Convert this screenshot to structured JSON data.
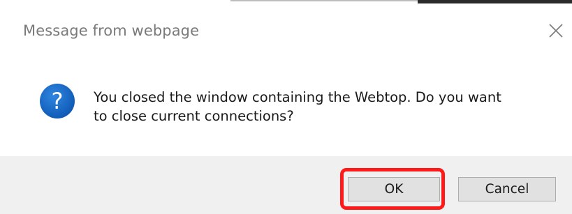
{
  "dialog": {
    "title": "Message from webpage",
    "close_icon": "close-icon",
    "question_icon": "question-mark-icon",
    "message_line1": "You closed the window containing the Webtop. Do you want",
    "message_line2": "to close current connections?",
    "buttons": {
      "ok_label": "OK",
      "cancel_label": "Cancel"
    },
    "highlighted_button": "OK"
  },
  "colors": {
    "icon_blue": "#1565c0",
    "highlight_red": "#ff1a1a",
    "footer_bg": "#f0f0f0",
    "button_bg": "#e1e1e1",
    "title_text": "#7a7a7a"
  }
}
